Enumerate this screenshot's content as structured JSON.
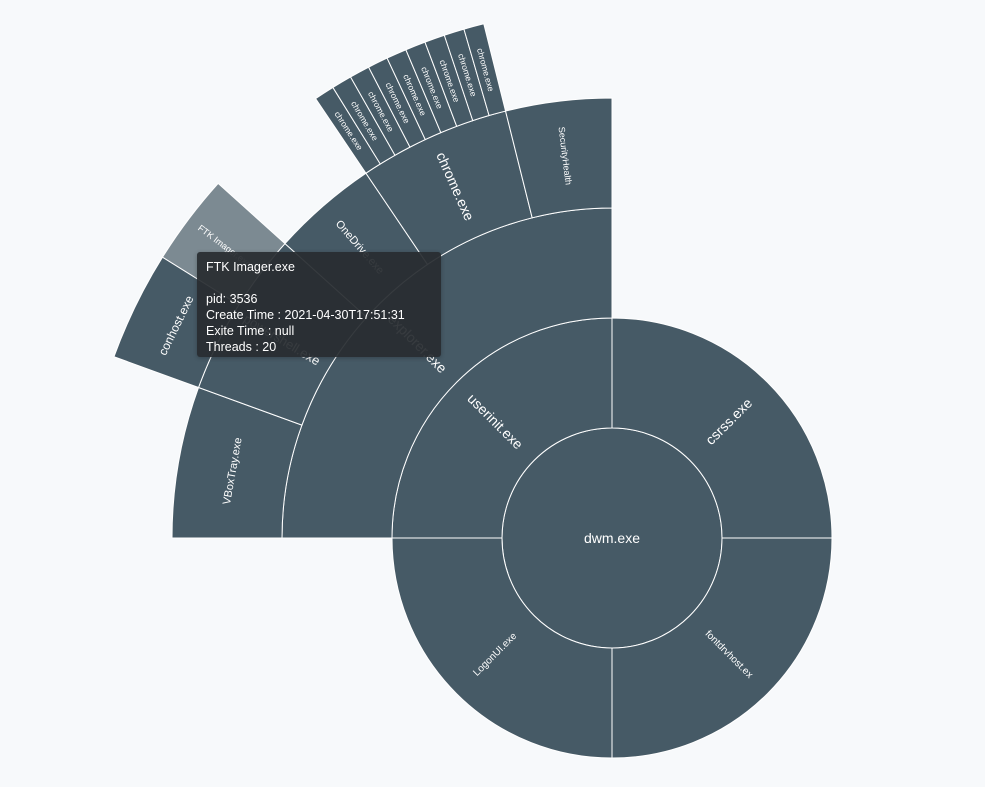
{
  "colors": {
    "segment": "#465a66",
    "highlight": "#7c8a92",
    "stroke": "#ffffff",
    "label": "#ffffff",
    "background": "#f7f9fb",
    "tooltip_bg": "#282c30"
  },
  "chart_data": {
    "type": "sunburst",
    "root": {
      "name": "dwm.exe",
      "children": [
        {
          "name": "csrss.exe",
          "children": []
        },
        {
          "name": "fontdrvhost.ex",
          "children": []
        },
        {
          "name": "LogonUI.exe",
          "children": []
        },
        {
          "name": "userinit.exe",
          "children": [
            {
              "name": "explorer.exe",
              "children": [
                {
                  "name": "VBoxTray.exe",
                  "children": []
                },
                {
                  "name": "powershell.exe",
                  "children": [
                    {
                      "name": "conhost.exe",
                      "children": []
                    },
                    {
                      "name": "FTK Imager.exe",
                      "highlighted": true,
                      "children": []
                    }
                  ]
                },
                {
                  "name": "OneDrive.exe",
                  "children": []
                },
                {
                  "name": "chrome.exe",
                  "children": [
                    {
                      "name": "chrome.exe",
                      "children": []
                    },
                    {
                      "name": "chrome.exe",
                      "children": []
                    },
                    {
                      "name": "chrome.exe",
                      "children": []
                    },
                    {
                      "name": "chrome.exe",
                      "children": []
                    },
                    {
                      "name": "chrome.exe",
                      "children": []
                    },
                    {
                      "name": "chrome.exe",
                      "children": []
                    },
                    {
                      "name": "chrome.exe",
                      "children": []
                    },
                    {
                      "name": "chrome.exe",
                      "children": []
                    },
                    {
                      "name": "chrome.exe",
                      "children": []
                    }
                  ]
                },
                {
                  "name": "SecurityHealth",
                  "children": []
                }
              ]
            }
          ]
        }
      ]
    }
  },
  "tooltip": {
    "title": "FTK Imager.exe",
    "pid": "pid: 3536",
    "create_time": "Create Time : 2021-04-30T17:51:31",
    "exit_time": "Exite Time : null",
    "threads": "Threads : 20"
  }
}
